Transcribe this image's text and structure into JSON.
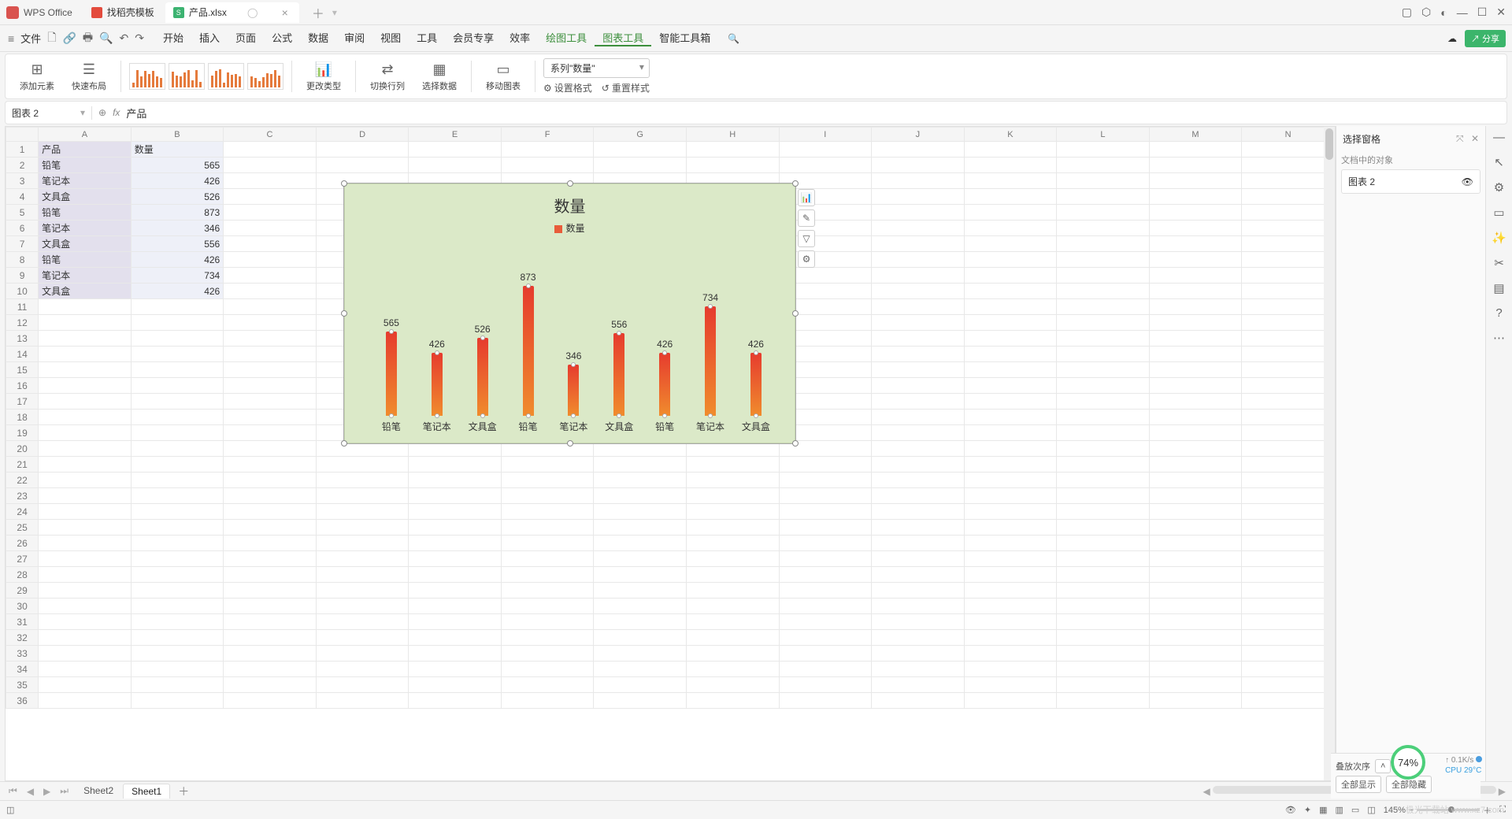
{
  "titlebar": {
    "app": "WPS Office",
    "tab_template": "找稻壳模板",
    "tab_doc": "产品.xlsx",
    "tab_doc_badge": "S"
  },
  "menubar": {
    "file": "文件",
    "items": [
      "开始",
      "插入",
      "页面",
      "公式",
      "数据",
      "审阅",
      "视图",
      "工具",
      "会员专享",
      "效率",
      "绘图工具",
      "图表工具",
      "智能工具箱"
    ],
    "share": "分享"
  },
  "ribbon": {
    "add_element": "添加元素",
    "quick_layout": "快速布局",
    "change_type": "更改类型",
    "switch_rc": "切换行列",
    "select_data": "选择数据",
    "move_chart": "移动图表",
    "series_selector": "系列\"数量\"",
    "set_format": "设置格式",
    "reset_style": "重置样式"
  },
  "fbar": {
    "namebox": "图表 2",
    "fx": "fx",
    "content": "产品"
  },
  "columns": [
    "A",
    "B",
    "C",
    "D",
    "E",
    "F",
    "G",
    "H",
    "I",
    "J",
    "K",
    "L",
    "M",
    "N"
  ],
  "table": {
    "header": [
      "产品",
      "数量"
    ],
    "rows": [
      [
        "铅笔",
        565
      ],
      [
        "笔记本",
        426
      ],
      [
        "文具盒",
        526
      ],
      [
        "铅笔",
        873
      ],
      [
        "笔记本",
        346
      ],
      [
        "文具盒",
        556
      ],
      [
        "铅笔",
        426
      ],
      [
        "笔记本",
        734
      ],
      [
        "文具盒",
        426
      ]
    ]
  },
  "chart_data": {
    "type": "bar",
    "title": "数量",
    "legend": "数量",
    "categories": [
      "铅笔",
      "笔记本",
      "文具盒",
      "铅笔",
      "笔记本",
      "文具盒",
      "铅笔",
      "笔记本",
      "文具盒"
    ],
    "values": [
      565,
      426,
      526,
      873,
      346,
      556,
      426,
      734,
      426
    ],
    "ylim": [
      0,
      900
    ]
  },
  "rightpanel": {
    "title": "选择窗格",
    "subtitle": "文档中的对象",
    "object": "图表 2",
    "stack_order": "叠放次序",
    "show_all": "全部显示",
    "hide_all": "全部隐藏"
  },
  "sheettabs": {
    "tabs": [
      "Sheet2",
      "Sheet1"
    ],
    "active": 1
  },
  "status": {
    "zoom": "145%",
    "gauge": "74%",
    "net": "0.1K/s",
    "cpu": "CPU 29°C"
  },
  "watermark": "极光下载站 www.xz7.com"
}
